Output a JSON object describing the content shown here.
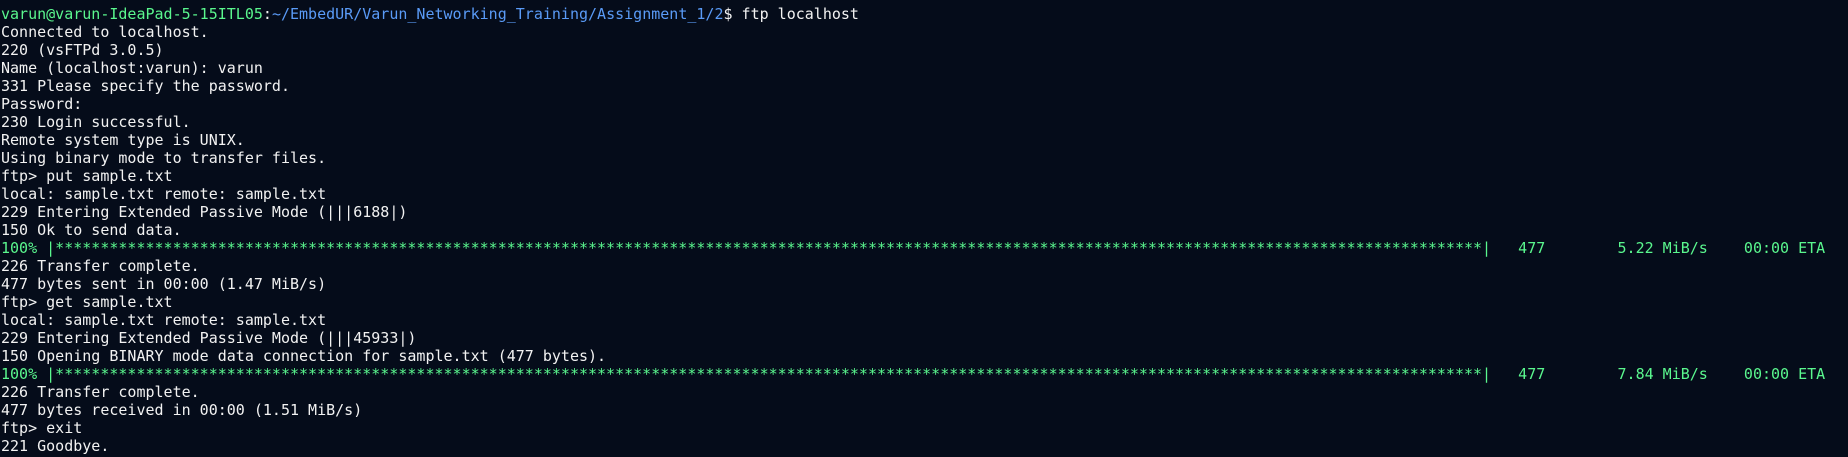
{
  "prompt": {
    "user_host": "varun@varun-IdeaPad-5-15ITL05",
    "separator": ":",
    "path": "~/EmbedUR/Varun_Networking_Training/Assignment_1/2",
    "symbol": "$",
    "command": " ftp localhost"
  },
  "lines": [
    "Connected to localhost.",
    "220 (vsFTPd 3.0.5)",
    "Name (localhost:varun): varun",
    "331 Please specify the password.",
    "Password:",
    "230 Login successful.",
    "Remote system type is UNIX.",
    "Using binary mode to transfer files.",
    "ftp> put sample.txt",
    "local: sample.txt remote: sample.txt",
    "229 Entering Extended Passive Mode (|||6188|)",
    "150 Ok to send data."
  ],
  "progress1": {
    "text": "100% |**************************************************************************************************************************************************************|   477        5.22 MiB/s    00:00 ETA"
  },
  "lines2": [
    "226 Transfer complete.",
    "477 bytes sent in 00:00 (1.47 MiB/s)",
    "ftp> get sample.txt",
    "local: sample.txt remote: sample.txt",
    "229 Entering Extended Passive Mode (|||45933|)",
    "150 Opening BINARY mode data connection for sample.txt (477 bytes)."
  ],
  "progress2": {
    "text": "100% |**************************************************************************************************************************************************************|   477        7.84 MiB/s    00:00 ETA"
  },
  "lines3": [
    "226 Transfer complete.",
    "477 bytes received in 00:00 (1.51 MiB/s)",
    "ftp> exit",
    "221 Goodbye."
  ],
  "colors": {
    "background": "#050c1a",
    "text": "#f2f2f2",
    "prompt_user": "#5af78e",
    "prompt_path": "#5a9bf7"
  }
}
